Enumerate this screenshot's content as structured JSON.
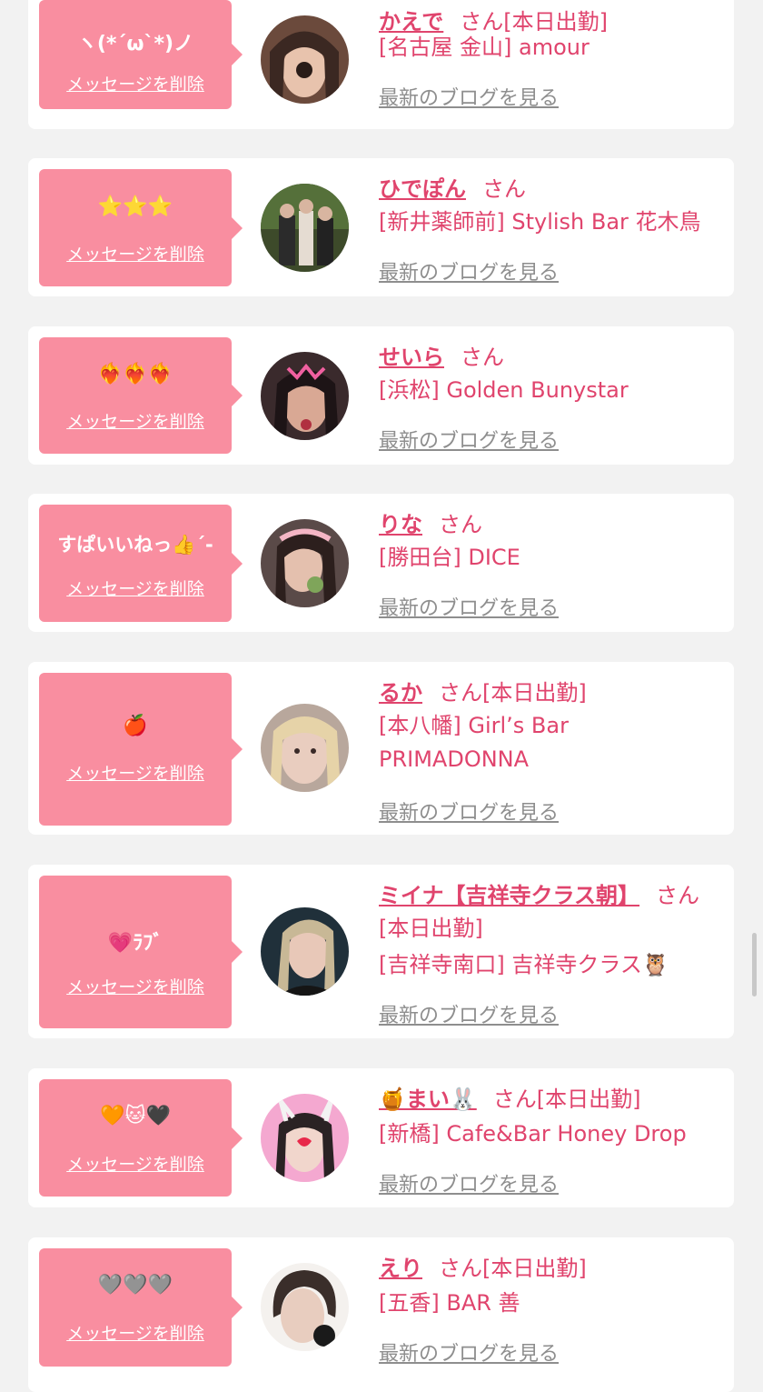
{
  "colors": {
    "bubble": "#f98ea0",
    "accent": "#e0446d",
    "link_gray": "#8e8e8e",
    "page_bg": "#f2f2f2"
  },
  "delete_label": "メッセージを削除",
  "blog_label": "最新のブログを見る",
  "san_label": "さん",
  "entries": [
    {
      "message": "ヽ(*ˊωˋ*)ノ",
      "name": "かえで",
      "status": "[本日出勤]",
      "shop": "[名古屋 金山] amour"
    },
    {
      "message": "⭐⭐⭐",
      "name": "ひでぽん",
      "status": "",
      "shop": "[新井薬師前] Stylish Bar 花木鳥"
    },
    {
      "message": "❤️‍🔥❤️‍🔥❤️‍🔥",
      "name": "せいら",
      "status": "",
      "shop": "[浜松] Golden Bunystar"
    },
    {
      "message": "すぱいいねっ👍ˊ-",
      "name": "りな",
      "status": "",
      "shop": "[勝田台] DICE"
    },
    {
      "message": "🍎",
      "name": "るか",
      "status": "[本日出勤]",
      "shop": "[本八幡] Girl’s Bar PRIMADONNA"
    },
    {
      "message": "💗ﾗﾌﾞ",
      "name": "ミイナ【吉祥寺クラス朝】",
      "status": "[本日出勤]",
      "shop": "[吉祥寺南口] 吉祥寺クラス🦉"
    },
    {
      "message": "🧡🐱🖤",
      "name": "🍯まい🐰",
      "status": "[本日出勤]",
      "shop": "[新橋] Cafe&Bar Honey Drop"
    },
    {
      "message": "🩶🩶🩶",
      "name": "えり",
      "status": "[本日出勤]",
      "shop": "[五香] BAR 善"
    }
  ]
}
